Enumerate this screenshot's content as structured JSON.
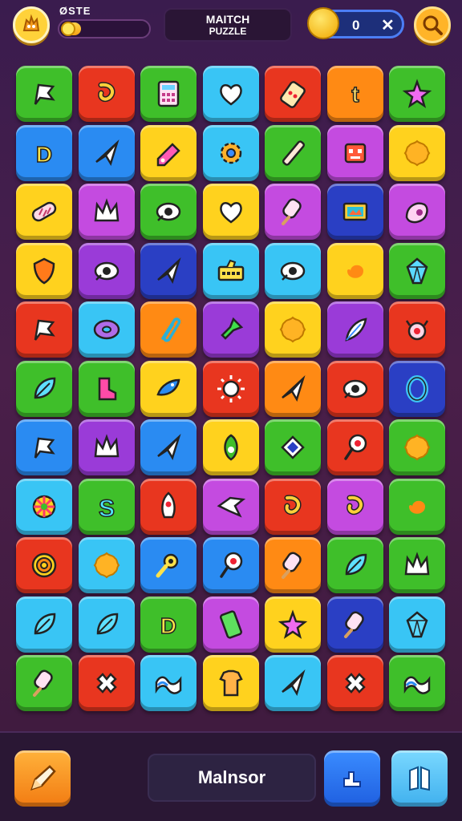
{
  "header": {
    "player_label": "ØSTE",
    "xp_progress": 0.22,
    "title_line1": "MAITCH",
    "title_line2": "PUZZLE",
    "coin_count": "0",
    "coin_close": "✕"
  },
  "bottom": {
    "mode_label": "Malnsor"
  },
  "colors": {
    "green": "#3fbf2a",
    "red": "#e8361f",
    "blue": "#2a8bf2",
    "cyan": "#39c5f5",
    "yellow": "#ffd21e",
    "orange": "#ff8a14",
    "purple": "#9a3bd8",
    "magenta": "#c44be0",
    "navy": "#2a3fc4"
  },
  "board": {
    "rows": [
      [
        {
          "c": "green",
          "i": "flag"
        },
        {
          "c": "red",
          "i": "hook"
        },
        {
          "c": "green",
          "i": "calculator"
        },
        {
          "c": "cyan",
          "i": "heart"
        },
        {
          "c": "red",
          "i": "phone"
        },
        {
          "c": "orange",
          "i": "letter-t"
        },
        {
          "c": "green",
          "i": "star"
        }
      ],
      [
        {
          "c": "blue",
          "i": "letter-d"
        },
        {
          "c": "blue",
          "i": "plane"
        },
        {
          "c": "yellow",
          "i": "pencil"
        },
        {
          "c": "cyan",
          "i": "gear"
        },
        {
          "c": "green",
          "i": "stick"
        },
        {
          "c": "magenta",
          "i": "robot"
        },
        {
          "c": "yellow",
          "i": "flower"
        }
      ],
      [
        {
          "c": "yellow",
          "i": "bandage"
        },
        {
          "c": "magenta",
          "i": "crown"
        },
        {
          "c": "green",
          "i": "eye"
        },
        {
          "c": "yellow",
          "i": "heart"
        },
        {
          "c": "magenta",
          "i": "popsicle"
        },
        {
          "c": "navy",
          "i": "screen"
        },
        {
          "c": "magenta",
          "i": "shell"
        }
      ],
      [
        {
          "c": "yellow",
          "i": "shield"
        },
        {
          "c": "purple",
          "i": "eye"
        },
        {
          "c": "navy",
          "i": "plane"
        },
        {
          "c": "cyan",
          "i": "keyboard"
        },
        {
          "c": "cyan",
          "i": "eye"
        },
        {
          "c": "yellow",
          "i": "spiral"
        },
        {
          "c": "green",
          "i": "gem"
        }
      ],
      [
        {
          "c": "red",
          "i": "flag"
        },
        {
          "c": "cyan",
          "i": "donut"
        },
        {
          "c": "orange",
          "i": "paperclip"
        },
        {
          "c": "purple",
          "i": "pin"
        },
        {
          "c": "yellow",
          "i": "flower"
        },
        {
          "c": "purple",
          "i": "feather"
        },
        {
          "c": "red",
          "i": "crab"
        }
      ],
      [
        {
          "c": "green",
          "i": "leaf"
        },
        {
          "c": "green",
          "i": "boot"
        },
        {
          "c": "yellow",
          "i": "fish"
        },
        {
          "c": "red",
          "i": "sun"
        },
        {
          "c": "orange",
          "i": "plane"
        },
        {
          "c": "red",
          "i": "eye"
        },
        {
          "c": "navy",
          "i": "ring"
        }
      ],
      [
        {
          "c": "blue",
          "i": "flag"
        },
        {
          "c": "purple",
          "i": "crown"
        },
        {
          "c": "blue",
          "i": "plane"
        },
        {
          "c": "yellow",
          "i": "seed"
        },
        {
          "c": "green",
          "i": "diamond"
        },
        {
          "c": "red",
          "i": "lollipop"
        },
        {
          "c": "green",
          "i": "flower"
        }
      ],
      [
        {
          "c": "cyan",
          "i": "wheel"
        },
        {
          "c": "green",
          "i": "letter-s"
        },
        {
          "c": "red",
          "i": "rocket"
        },
        {
          "c": "magenta",
          "i": "bird"
        },
        {
          "c": "red",
          "i": "hook"
        },
        {
          "c": "magenta",
          "i": "hook"
        },
        {
          "c": "green",
          "i": "spiral"
        }
      ],
      [
        {
          "c": "red",
          "i": "target"
        },
        {
          "c": "cyan",
          "i": "flower"
        },
        {
          "c": "blue",
          "i": "key"
        },
        {
          "c": "blue",
          "i": "lollipop"
        },
        {
          "c": "orange",
          "i": "popsicle"
        },
        {
          "c": "green",
          "i": "leaf"
        },
        {
          "c": "green",
          "i": "crown"
        }
      ],
      [
        {
          "c": "cyan",
          "i": "leaf"
        },
        {
          "c": "cyan",
          "i": "leaf"
        },
        {
          "c": "green",
          "i": "letter-d"
        },
        {
          "c": "magenta",
          "i": "battery"
        },
        {
          "c": "yellow",
          "i": "star"
        },
        {
          "c": "navy",
          "i": "popsicle"
        },
        {
          "c": "cyan",
          "i": "gem"
        }
      ],
      [
        {
          "c": "green",
          "i": "popsicle"
        },
        {
          "c": "red",
          "i": "cross"
        },
        {
          "c": "cyan",
          "i": "wave"
        },
        {
          "c": "yellow",
          "i": "shirt"
        },
        {
          "c": "cyan",
          "i": "plane"
        },
        {
          "c": "red",
          "i": "cross"
        },
        {
          "c": "green",
          "i": "wave"
        }
      ]
    ]
  }
}
